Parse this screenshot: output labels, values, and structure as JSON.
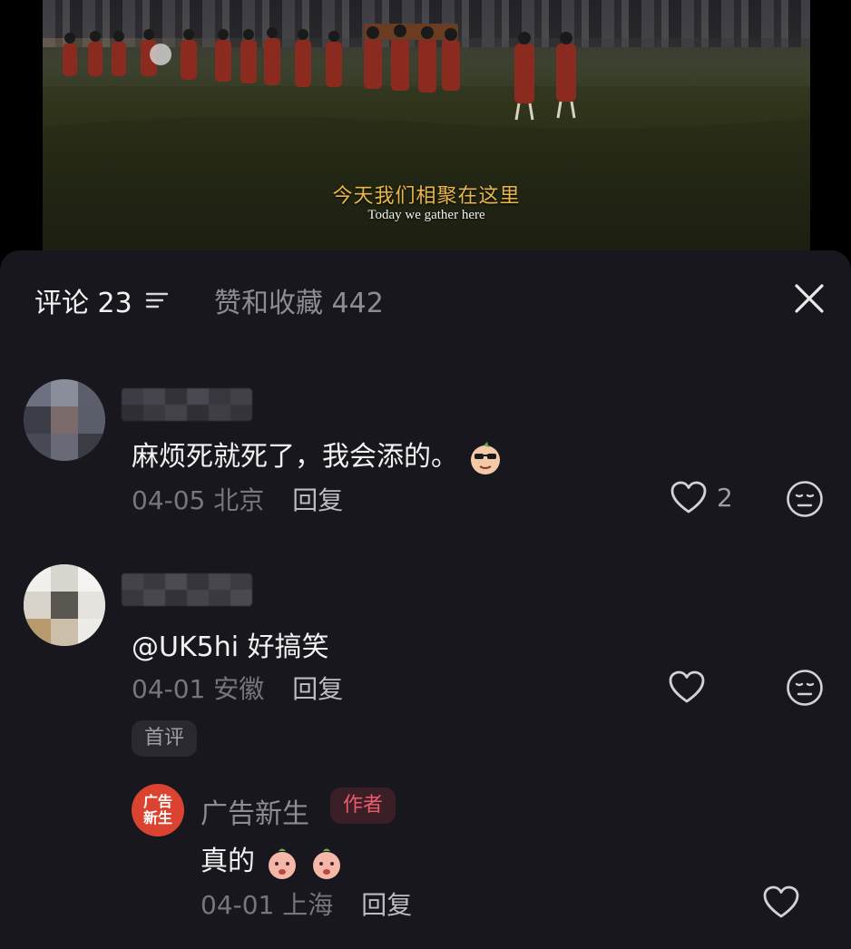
{
  "video": {
    "subtitle_cn": "今天我们相聚在这里",
    "subtitle_en": "Today we gather here"
  },
  "sheet": {
    "tab_comments": "评论 23",
    "tab_likes": "赞和收藏 442",
    "comments": [
      {
        "text": "麻烦死就死了，我会添的。",
        "emoji": "sunglasses-face-emoji",
        "date": "04-05",
        "location": "北京",
        "reply_label": "回复",
        "like_count": "2"
      },
      {
        "text": "@UK5hi 好搞笑",
        "date": "04-01",
        "location": "安徽",
        "reply_label": "回复",
        "badge": "首评"
      }
    ],
    "reply": {
      "avatar_text_line1": "广告",
      "avatar_text_line2": "新生",
      "author": "广告新生",
      "author_badge": "作者",
      "text": "真的",
      "emoji": "peach-face-emoji",
      "date": "04-01",
      "location": "上海",
      "reply_label": "回复"
    }
  },
  "colors": {
    "sheet_bg": "#18171d",
    "author_badge_text": "#ee5a6c",
    "subtitle_cn": "#e9b64a"
  }
}
